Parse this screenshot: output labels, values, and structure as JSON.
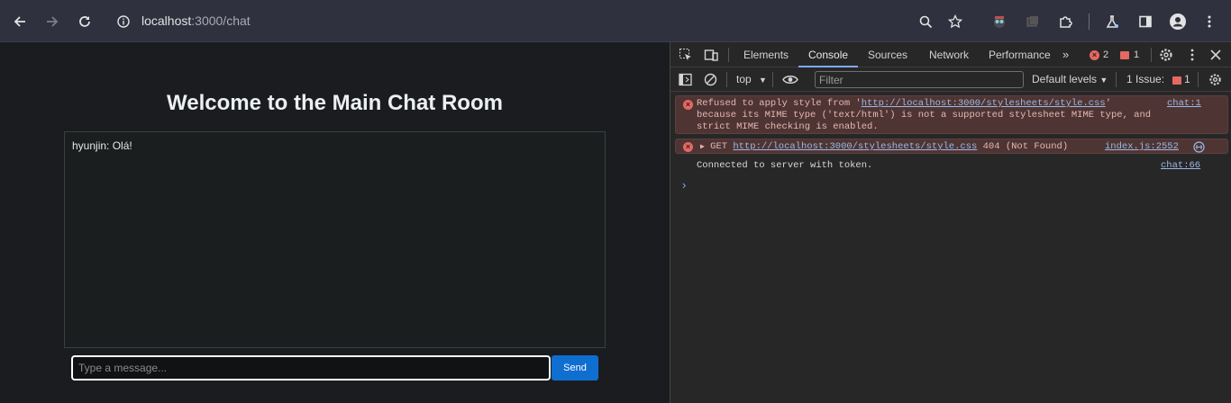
{
  "browser": {
    "url_host": "localhost",
    "url_path": ":3000/chat"
  },
  "page": {
    "title": "Welcome to the Main Chat Room",
    "messages": [
      "hyunjin: Olá!"
    ],
    "input_placeholder": "Type a message...",
    "send_label": "Send"
  },
  "devtools": {
    "tabs": [
      "Elements",
      "Console",
      "Sources",
      "Network",
      "Performance"
    ],
    "active_tab": "Console",
    "error_count": "2",
    "warning_count": "1",
    "context": "top",
    "filter_placeholder": "Filter",
    "levels": "Default levels",
    "issues_label": "1 Issue:",
    "issues_count": "1",
    "console": [
      {
        "type": "error",
        "text_before": "Refused to apply style from '",
        "link": "http://localhost:3000/stylesheets/style.css",
        "text_after_1": "'",
        "line2": "because its MIME type ('text/html') is not a supported stylesheet MIME type, and",
        "line3": "strict MIME checking is enabled.",
        "source": "chat:1"
      },
      {
        "type": "error",
        "method": "GET",
        "link": "http://localhost:3000/stylesheets/style.css",
        "status": "404 (Not Found)",
        "source": "index.js:2552"
      },
      {
        "type": "info",
        "text": "Connected to server with token.",
        "source": "chat:66"
      }
    ]
  },
  "colors": {
    "accent": "#7cacf8",
    "send_button": "#0f6fd0",
    "error_bg": "#4e3534"
  }
}
